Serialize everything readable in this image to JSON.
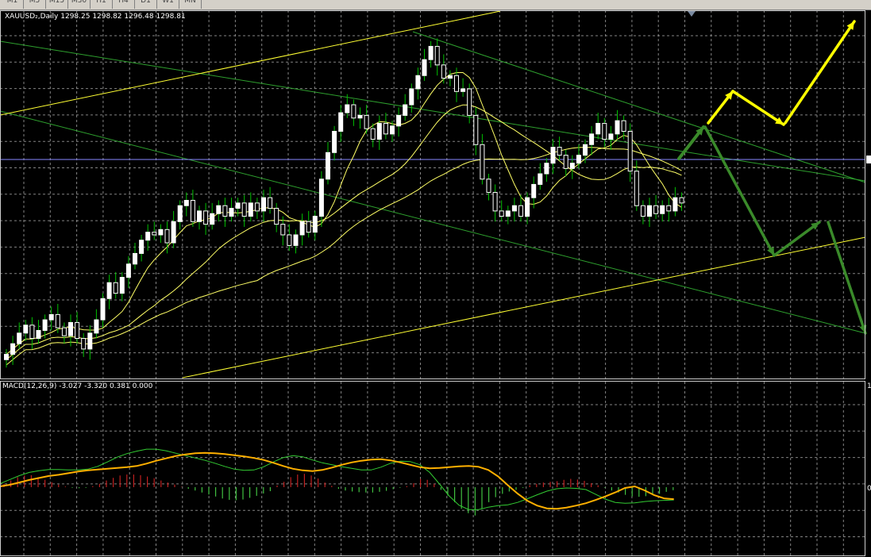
{
  "timeframes": [
    "M1",
    "M5",
    "M15",
    "M30",
    "H1",
    "H4",
    "D1",
    "W1",
    "MN"
  ],
  "main_title": "XAUUSD₂,Daily  1298.25 1298.82 1296.48 1298.81",
  "macd_title": "MACD(12,26,9) -3.027 -3.320 0.381 0.000",
  "macd_axis_labels": [
    "1",
    "0"
  ],
  "colors": {
    "background": "#000000",
    "grid": "#9a9a9a",
    "candle": "#ffffff",
    "candle_shadow": "#00c000",
    "ma": "#ffff66",
    "channel": "#2ea02e",
    "trend": "#ffff33",
    "macd_line": "#ffb000",
    "signal_line": "#33cc33",
    "hist_pos": "#c02020",
    "hist_neg": "#40c040",
    "arrow_yellow": "#ffff00",
    "arrow_green": "#3a8a2a"
  },
  "chart_data": {
    "type": "candlestick",
    "symbol": "XAUUSD",
    "timeframe": "Daily",
    "ohlc_last": {
      "open": 1298.25,
      "high": 1298.82,
      "low": 1296.48,
      "close": 1298.81
    },
    "closes": [
      1262,
      1266,
      1270,
      1273,
      1268,
      1271,
      1275,
      1277,
      1272,
      1269,
      1274,
      1268,
      1264,
      1270,
      1275,
      1283,
      1289,
      1285,
      1291,
      1296,
      1300,
      1305,
      1308,
      1307,
      1309,
      1304,
      1312,
      1318,
      1320,
      1312,
      1316,
      1311,
      1315,
      1318,
      1314,
      1317,
      1319,
      1314,
      1319,
      1316,
      1321,
      1317,
      1311,
      1307,
      1303,
      1307,
      1312,
      1308,
      1314,
      1328,
      1338,
      1346,
      1353,
      1356,
      1351,
      1352,
      1347,
      1343,
      1349,
      1345,
      1348,
      1352,
      1356,
      1362,
      1367,
      1373,
      1378,
      1371,
      1366,
      1367,
      1361,
      1362,
      1352,
      1341,
      1328,
      1323,
      1316,
      1314,
      1316,
      1318,
      1314,
      1321,
      1326,
      1330,
      1334,
      1340,
      1337,
      1332,
      1334,
      1337,
      1341,
      1345,
      1349,
      1343,
      1345,
      1350,
      1346,
      1331,
      1318,
      1314,
      1318,
      1315,
      1318,
      1316,
      1321,
      1319
    ],
    "macd": {
      "macd_line": [
        0.2,
        0.6,
        1.2,
        1.8,
        2.3,
        2.8,
        3.1,
        3.5,
        3.9,
        4.2,
        4.4,
        4.6,
        4.8,
        5.0,
        5.3,
        5.9,
        6.6,
        7.2,
        7.8,
        8.2,
        8.5,
        8.6,
        8.5,
        8.3,
        8.0,
        7.7,
        7.3,
        6.8,
        6.1,
        5.3,
        4.6,
        4.2,
        4.0,
        4.3,
        4.9,
        5.6,
        6.2,
        6.6,
        6.9,
        7.0,
        6.7,
        6.2,
        5.6,
        5.0,
        4.7,
        4.8,
        5.0,
        5.2,
        5.3,
        5.1,
        4.3,
        2.7,
        0.5,
        -1.6,
        -3.4,
        -4.6,
        -5.3,
        -5.4,
        -5.1,
        -4.6,
        -4.0,
        -3.2,
        -2.3,
        -1.3,
        -0.2,
        0.2,
        -0.8,
        -2.0,
        -2.8,
        -3.0
      ],
      "signal_line": [
        0.9,
        1.9,
        2.9,
        3.7,
        4.1,
        4.4,
        4.4,
        4.3,
        4.3,
        4.5,
        5.2,
        6.3,
        7.5,
        8.4,
        9.0,
        9.5,
        9.5,
        9.1,
        8.5,
        7.9,
        7.3,
        6.7,
        6.0,
        5.2,
        4.5,
        4.2,
        4.3,
        5.1,
        6.3,
        7.4,
        7.9,
        7.6,
        6.8,
        6.1,
        5.6,
        5.1,
        4.7,
        4.3,
        4.3,
        5.0,
        6.0,
        6.5,
        6.4,
        5.6,
        3.7,
        0.8,
        -2.2,
        -4.5,
        -5.6,
        -5.6,
        -5.0,
        -4.6,
        -4.4,
        -3.8,
        -2.9,
        -1.9,
        -1.0,
        -0.4,
        -0.2,
        -0.3,
        -0.6,
        -1.8,
        -3.0,
        -3.8,
        -4.0,
        -3.9,
        -3.6,
        -3.4,
        -3.3,
        -3.2
      ],
      "histogram": [
        1.0,
        2.0,
        3.0,
        3.5,
        3.6,
        3.0,
        2.2,
        1.5,
        0.8,
        0.2,
        -0.2,
        -0.3,
        -0.2,
        0.3,
        1.0,
        2.0,
        2.8,
        3.5,
        3.8,
        3.8,
        3.6,
        3.2,
        2.7,
        2.0,
        1.4,
        0.8,
        0.1,
        -0.5,
        -1.0,
        -1.6,
        -2.2,
        -2.8,
        -3.4,
        -3.8,
        -3.9,
        -3.7,
        -3.2,
        -2.6,
        -1.9,
        -1.2,
        0.5,
        1.6,
        3.0,
        3.8,
        4.0,
        3.5,
        2.6,
        1.4,
        0.4,
        -0.5,
        -1.0,
        -1.3,
        -1.5,
        -1.6,
        -1.6,
        -1.4,
        -1.1,
        -0.6,
        -0.2,
        0.3,
        1.2,
        2.5,
        2.2,
        1.0,
        -0.8,
        -2.5,
        -4.5,
        -6.5,
        -7.8,
        -8.5,
        -6.5,
        -4.5,
        -3.0,
        -2.0,
        -1.3,
        -0.8,
        -0.2,
        0.6,
        1.0,
        1.4,
        1.6,
        1.8,
        2.2,
        2.5,
        2.3,
        1.9,
        1.2,
        0.6,
        -0.2,
        -1.0,
        -1.6,
        -2.3,
        -2.8,
        -2.9,
        -2.7,
        -2.4,
        -2.0,
        -1.4,
        -0.9
      ]
    }
  }
}
